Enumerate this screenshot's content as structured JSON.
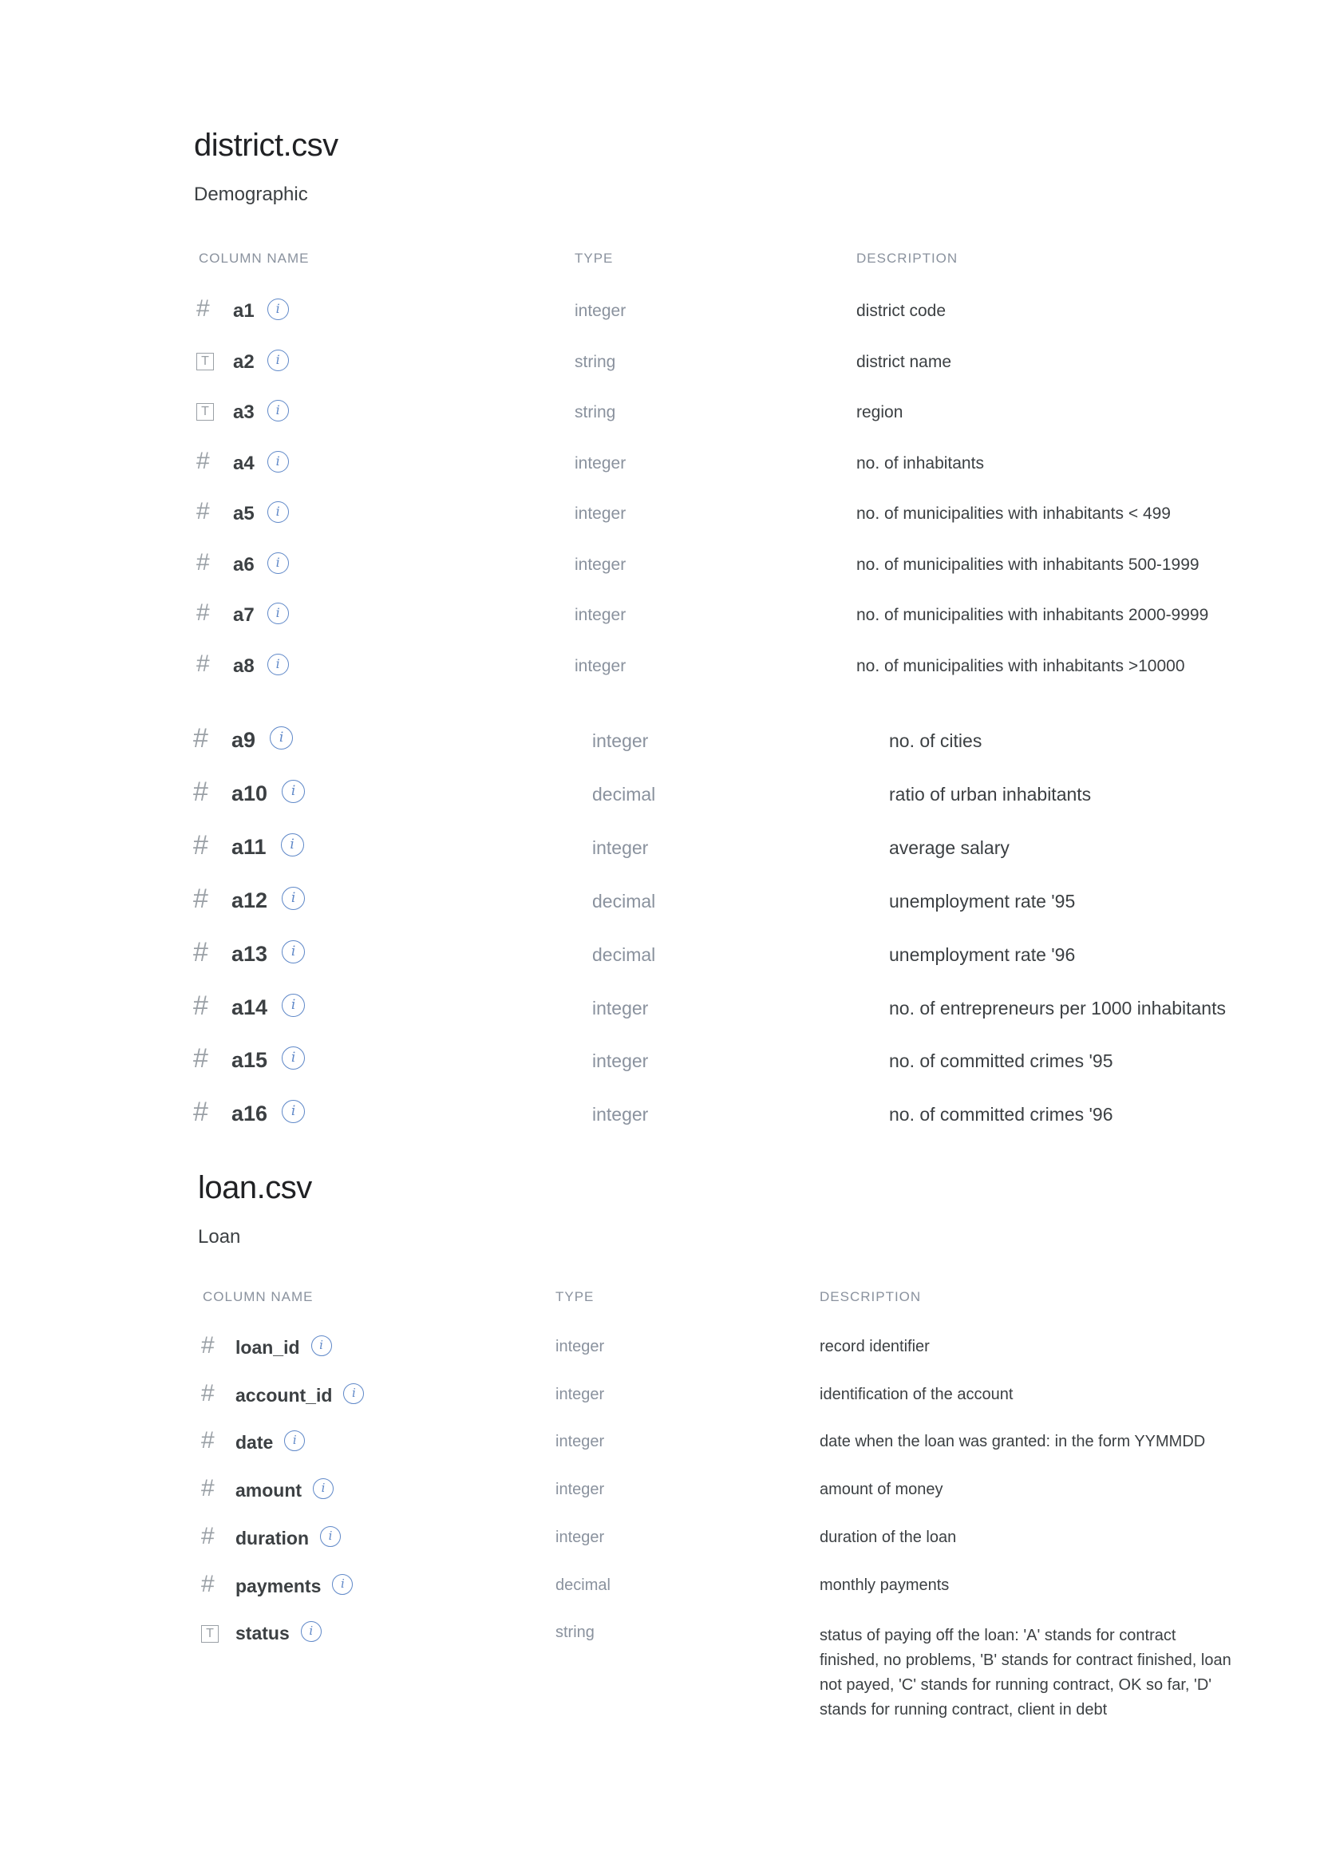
{
  "district": {
    "title": "district.csv",
    "subtitle": "Demographic",
    "headers": {
      "name": "COLUMN NAME",
      "type": "TYPE",
      "description": "DESCRIPTION"
    },
    "rows": [
      {
        "icon": "hash-icon",
        "glyph": "#",
        "name": "a1",
        "type": "integer",
        "description": "district code"
      },
      {
        "icon": "text-type-icon",
        "glyph": "T",
        "name": "a2",
        "type": "string",
        "description": "district name"
      },
      {
        "icon": "text-type-icon",
        "glyph": "T",
        "name": "a3",
        "type": "string",
        "description": "region"
      },
      {
        "icon": "hash-icon",
        "glyph": "#",
        "name": "a4",
        "type": "integer",
        "description": "no. of inhabitants"
      },
      {
        "icon": "hash-icon",
        "glyph": "#",
        "name": "a5",
        "type": "integer",
        "description": "no. of municipalities with inhabitants < 499"
      },
      {
        "icon": "hash-icon",
        "glyph": "#",
        "name": "a6",
        "type": "integer",
        "description": "no. of municipalities with inhabitants 500-1999"
      },
      {
        "icon": "hash-icon",
        "glyph": "#",
        "name": "a7",
        "type": "integer",
        "description": "no. of municipalities with inhabitants 2000-9999"
      },
      {
        "icon": "hash-icon",
        "glyph": "#",
        "name": "a8",
        "type": "integer",
        "description": "no. of municipalities with inhabitants >10000"
      },
      {
        "icon": "hash-icon",
        "glyph": "#",
        "name": "a9",
        "type": "integer",
        "description": "no. of cities"
      },
      {
        "icon": "hash-icon",
        "glyph": "#",
        "name": "a10",
        "type": "decimal",
        "description": "ratio of urban inhabitants"
      },
      {
        "icon": "hash-icon",
        "glyph": "#",
        "name": "a11",
        "type": "integer",
        "description": "average salary"
      },
      {
        "icon": "hash-icon",
        "glyph": "#",
        "name": "a12",
        "type": "decimal",
        "description": "unemployment rate '95"
      },
      {
        "icon": "hash-icon",
        "glyph": "#",
        "name": "a13",
        "type": "decimal",
        "description": "unemployment rate '96"
      },
      {
        "icon": "hash-icon",
        "glyph": "#",
        "name": "a14",
        "type": "integer",
        "description": "no. of entrepreneurs per 1000 inhabitants"
      },
      {
        "icon": "hash-icon",
        "glyph": "#",
        "name": "a15",
        "type": "integer",
        "description": "no. of committed crimes '95"
      },
      {
        "icon": "hash-icon",
        "glyph": "#",
        "name": "a16",
        "type": "integer",
        "description": "no. of committed crimes '96"
      }
    ]
  },
  "loan": {
    "title": "loan.csv",
    "subtitle": "Loan",
    "headers": {
      "name": "COLUMN NAME",
      "type": "TYPE",
      "description": "DESCRIPTION"
    },
    "rows": [
      {
        "icon": "hash-icon",
        "glyph": "#",
        "name": "loan_id",
        "type": "integer",
        "description": "record identifier"
      },
      {
        "icon": "hash-icon",
        "glyph": "#",
        "name": "account_id",
        "type": "integer",
        "description": "identification of the account"
      },
      {
        "icon": "hash-icon",
        "glyph": "#",
        "name": "date",
        "type": "integer",
        "description": "date when the loan was granted: in the form YYMMDD"
      },
      {
        "icon": "hash-icon",
        "glyph": "#",
        "name": "amount",
        "type": "integer",
        "description": "amount of money"
      },
      {
        "icon": "hash-icon",
        "glyph": "#",
        "name": "duration",
        "type": "integer",
        "description": "duration of the loan"
      },
      {
        "icon": "hash-icon",
        "glyph": "#",
        "name": "payments",
        "type": "decimal",
        "description": "monthly payments"
      },
      {
        "icon": "text-type-icon",
        "glyph": "T",
        "name": "status",
        "type": "string",
        "description": "status of paying off the loan: 'A' stands for contract finished, no problems, 'B' stands for contract finished, loan not payed, 'C' stands for running contract, OK so far, 'D' stands for running contract, client in debt"
      }
    ]
  },
  "info_glyph": "i"
}
